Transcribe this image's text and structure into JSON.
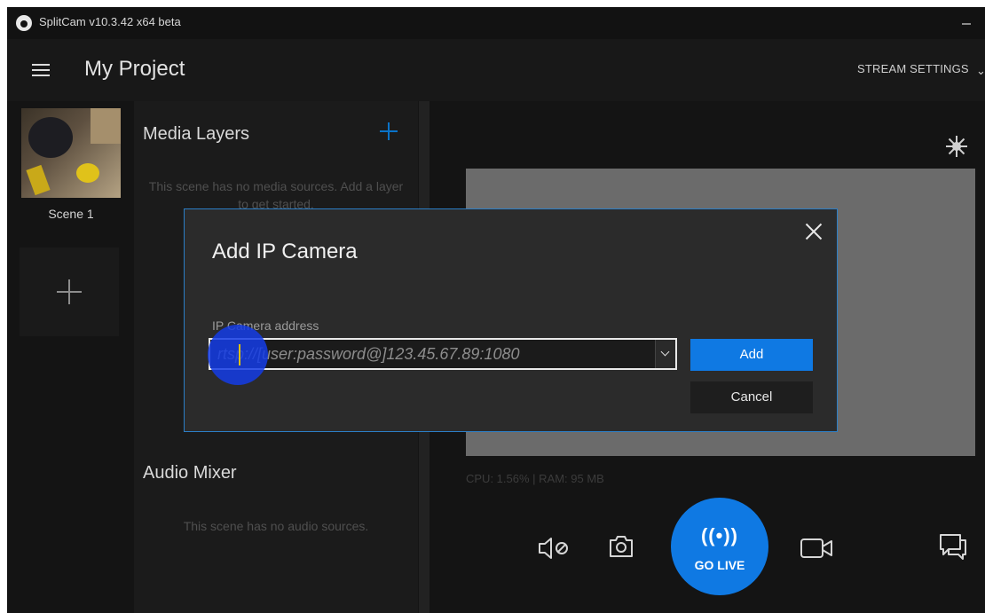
{
  "window": {
    "title": "SplitCam v10.3.42 x64 beta"
  },
  "header": {
    "project_title": "My Project",
    "stream_settings_label": "STREAM SETTINGS"
  },
  "scenes": [
    {
      "label": "Scene 1"
    }
  ],
  "media_layers": {
    "title": "Media Layers",
    "empty_text": "This scene has no media sources. Add a layer to get started."
  },
  "audio_mixer": {
    "title": "Audio Mixer",
    "empty_text": "This scene has no audio sources."
  },
  "status": {
    "cpu_ram": "CPU: 1.56% | RAM: 95 MB"
  },
  "controls": {
    "go_live_waves": "((•))",
    "go_live_label": "GO LIVE",
    "icons": [
      "speaker-mute-icon",
      "camera-snapshot-icon",
      "broadcast-icon",
      "video-camera-icon",
      "chat-icon",
      "brightness-icon"
    ]
  },
  "dialog": {
    "title": "Add IP Camera",
    "field_label": "IP Camera address",
    "placeholder": "rtsp://[user:password@]123.45.67.89:1080",
    "add_label": "Add",
    "cancel_label": "Cancel"
  },
  "colors": {
    "accent": "#0f79e3",
    "background": "#141414",
    "dialog_border": "#2b7ec6"
  }
}
